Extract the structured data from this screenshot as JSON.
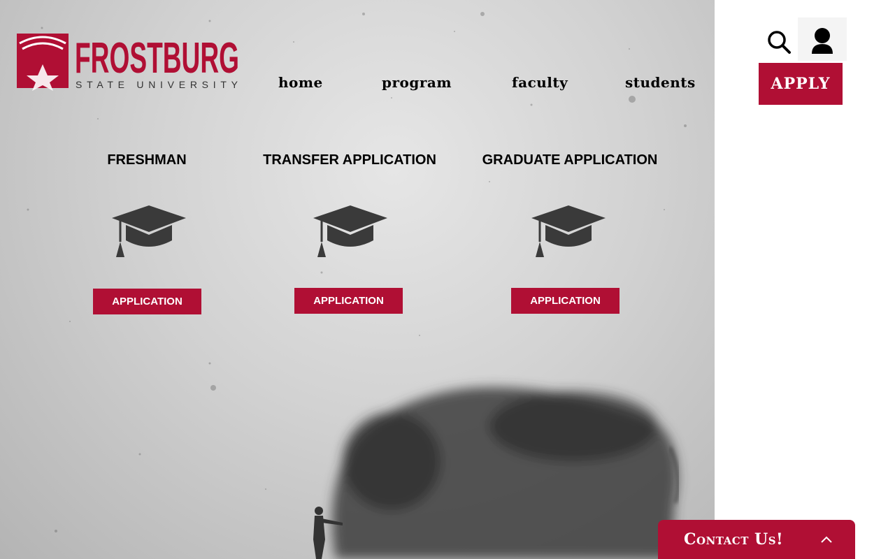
{
  "brand": {
    "name": "FROSTBURG",
    "subtitle": "STATE UNIVERSITY",
    "color": "#b00f34"
  },
  "nav": {
    "items": [
      "home",
      "program",
      "faculty",
      "students"
    ]
  },
  "header": {
    "search_icon": "search-icon",
    "user_icon": "user-icon",
    "apply_label": "APPLY"
  },
  "applications": [
    {
      "title": "FRESHMAN",
      "icon": "graduation-cap-icon",
      "button": "APPLICATION"
    },
    {
      "title": "TRANSFER APPLICATION",
      "icon": "graduation-cap-icon",
      "button": "APPLICATION"
    },
    {
      "title": "GRADUATE APPLICATION",
      "icon": "graduation-cap-icon",
      "button": "APPLICATION"
    }
  ],
  "contact": {
    "label": "Contact Us!",
    "icon": "chevron-up-icon"
  },
  "colors": {
    "accent": "#b00f34",
    "icon_dark": "#3a3a3a"
  }
}
